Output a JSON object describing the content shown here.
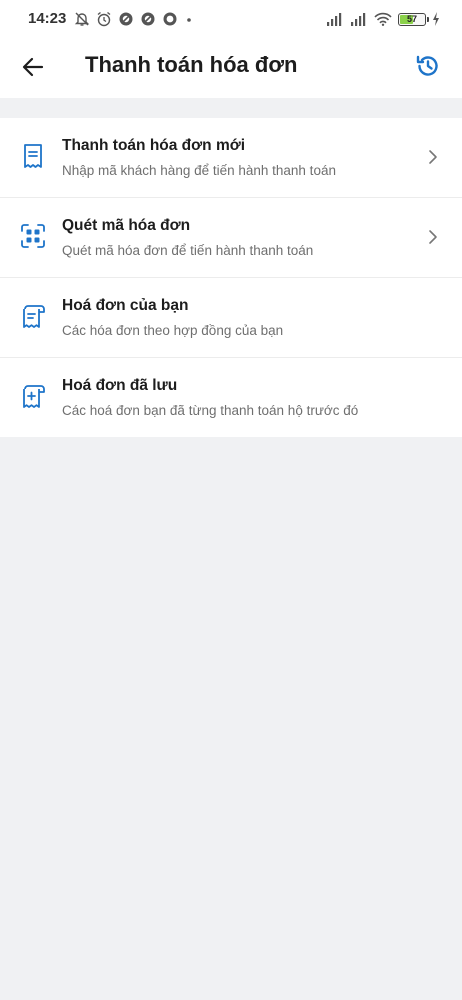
{
  "status_bar": {
    "time": "14:23",
    "battery_level": "57",
    "battery_percent": 57,
    "icons": [
      "notifications-off-icon",
      "alarm-icon",
      "app-icon",
      "app-icon",
      "app-icon",
      "dot-icon",
      "signal-icon",
      "signal-icon",
      "wifi-icon",
      "battery-icon",
      "charging-icon"
    ]
  },
  "header": {
    "title": "Thanh toán hóa đơn",
    "back_icon": "arrow-left-icon",
    "history_icon": "history-icon"
  },
  "menu": {
    "items": [
      {
        "title": "Thanh toán hóa đơn mới",
        "subtitle": "Nhập mã khách hàng để tiến hành thanh toán",
        "icon": "receipt-icon",
        "chevron": true
      },
      {
        "title": "Quét mã hóa đơn",
        "subtitle": "Quét mã hóa đơn để tiến hành thanh toán",
        "icon": "scan-qr-icon",
        "chevron": true
      },
      {
        "title": "Hoá đơn của bạn",
        "subtitle": "Các hóa đơn theo hợp đồng của bạn",
        "icon": "bill-list-icon",
        "chevron": false
      },
      {
        "title": "Hoá đơn đã lưu",
        "subtitle": "Các hoá đơn bạn đã từng thanh toán hộ trước đó",
        "icon": "saved-bill-icon",
        "chevron": false
      }
    ]
  },
  "colors": {
    "accent": "#1e74c9",
    "background": "#f0f1f3",
    "card": "#ffffff",
    "battery_fill": "#8bd14a"
  }
}
